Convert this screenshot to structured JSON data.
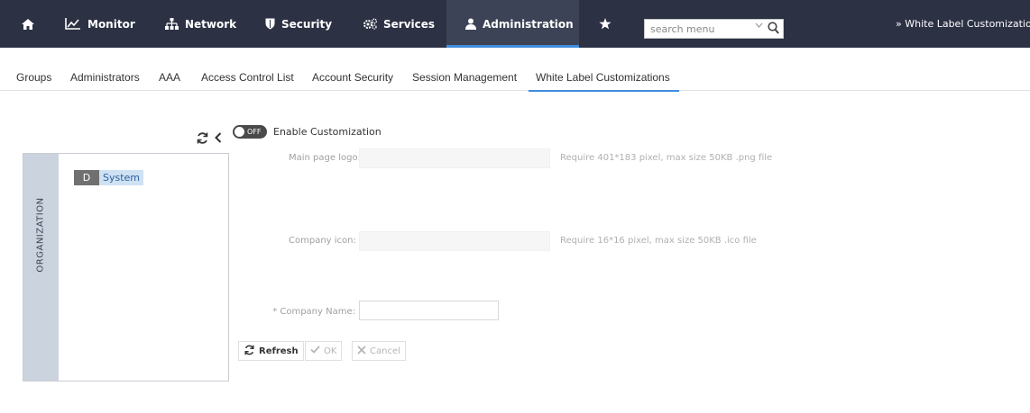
{
  "nav": {
    "items": [
      {
        "icon": "home-icon"
      },
      {
        "label": "Monitor",
        "icon": "chart-line-icon"
      },
      {
        "label": "Network",
        "icon": "network-icon"
      },
      {
        "label": "Security",
        "icon": "shield-icon"
      },
      {
        "label": "Services",
        "icon": "gears-icon"
      },
      {
        "label": "Administration",
        "icon": "user-icon",
        "active": true
      },
      {
        "icon": "star-icon"
      }
    ],
    "search": {
      "placeholder": "search menu"
    },
    "breadcrumb": "» White Label Customization:"
  },
  "tabs": [
    {
      "label": "Groups"
    },
    {
      "label": "Administrators"
    },
    {
      "label": "AAA"
    },
    {
      "label": "Access Control List"
    },
    {
      "label": "Account Security"
    },
    {
      "label": "Session Management"
    },
    {
      "label": "White Label Customizations",
      "active": true
    }
  ],
  "org_panel": {
    "title": "ORGANIZATION",
    "node": {
      "badge": "D",
      "label": "System"
    }
  },
  "customization": {
    "toggle_state": "OFF",
    "enable_label": "Enable Customization",
    "main_logo_label": "Main page logo:",
    "main_logo_hint": "Require 401*183 pixel, max size 50KB .png file",
    "company_icon_label": "Company icon:",
    "company_icon_hint": "Require 16*16 pixel, max size 50KB .ico file",
    "company_name_label": "* Company Name:",
    "company_name_value": ""
  },
  "buttons": {
    "refresh": "Refresh",
    "ok": "OK",
    "cancel": "Cancel"
  },
  "colors": {
    "nav_bg": "#2c3144",
    "accent": "#3e8ddd",
    "org_strip": "#cbd3de"
  }
}
